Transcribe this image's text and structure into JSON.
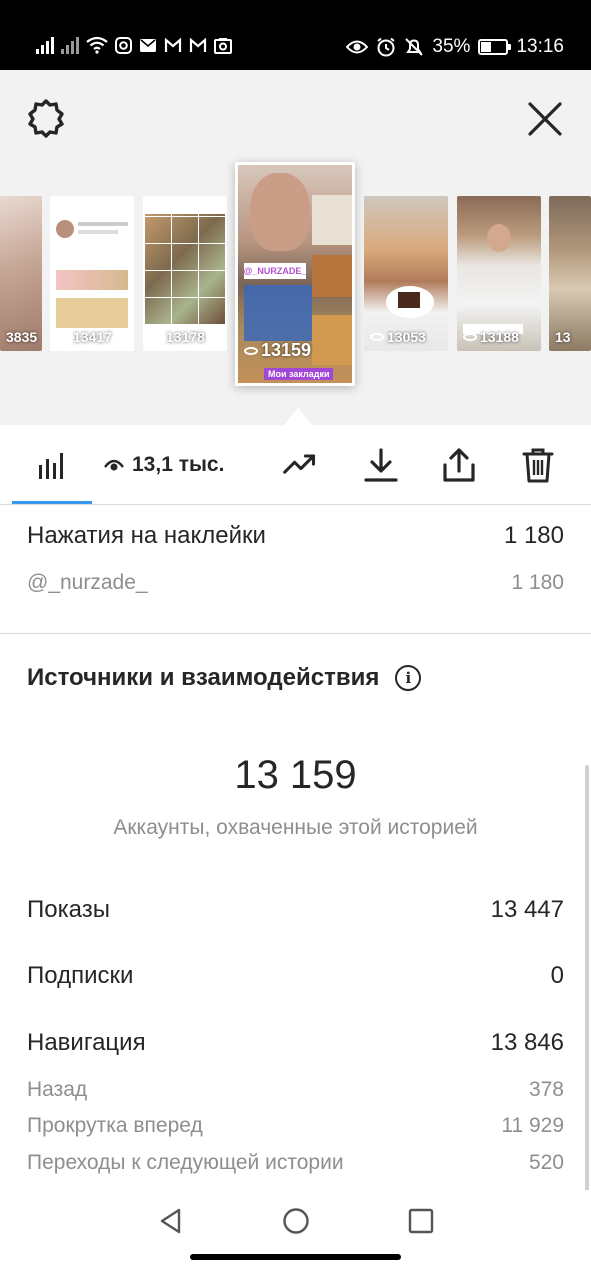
{
  "status_bar": {
    "left_icons": [
      "signal-icon",
      "signal-2-icon",
      "wifi-icon",
      "instagram-icon",
      "mail-icon",
      "gmail-icon",
      "gmail-2-icon",
      "photo-icon"
    ],
    "right_icons": [
      "eye-icon",
      "alarm-icon",
      "mute-icon"
    ],
    "battery": "35%",
    "time": "13:16"
  },
  "stories": [
    {
      "count": "3835"
    },
    {
      "count": "13417"
    },
    {
      "count": "13178"
    },
    {
      "count": "13159",
      "selected": true,
      "tag": "@_NURZADE_",
      "caption": "Мои закладки"
    },
    {
      "count": "13053"
    },
    {
      "count": "13188"
    },
    {
      "count": "13"
    }
  ],
  "tabs": {
    "views": "13,1 тыс."
  },
  "stickers": {
    "title": "Нажатия на наклейки",
    "total": "1 180",
    "account": "@_nurzade_",
    "account_value": "1 180"
  },
  "sources": {
    "title": "Источники и взаимодействия",
    "reach": "13 159",
    "reach_label": "Аккаунты, охваченные этой историей",
    "impressions_label": "Показы",
    "impressions": "13 447",
    "follows_label": "Подписки",
    "follows": "0",
    "navigation_label": "Навигация",
    "navigation": "13 846",
    "back_label": "Назад",
    "back": "378",
    "forward_label": "Прокрутка вперед",
    "forward": "11 929",
    "next_label": "Переходы к следующей истории",
    "next": "520"
  },
  "colors": {
    "accent": "#3897f0",
    "text": "#262626",
    "secondary": "#8e8e8e"
  }
}
